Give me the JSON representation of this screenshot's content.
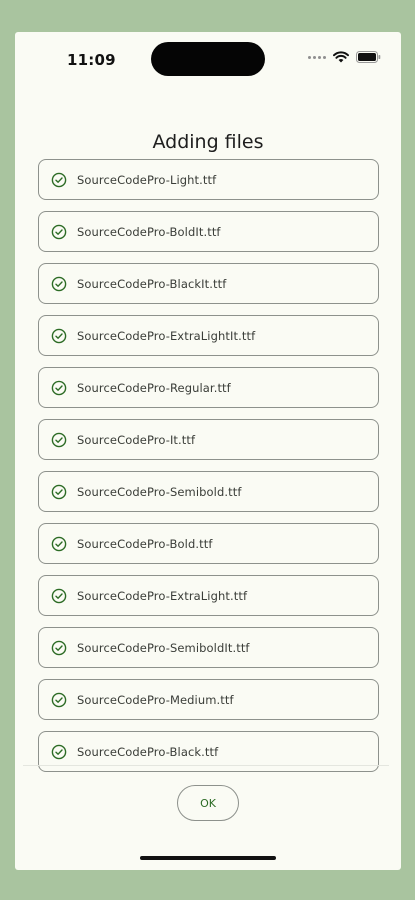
{
  "status_bar": {
    "time": "11:09",
    "icons": [
      "signal-dots-icon",
      "wifi-icon",
      "battery-icon"
    ]
  },
  "dialog": {
    "title": "Adding files",
    "files": [
      "SourceCodePro-Light.ttf",
      "SourceCodePro-BoldIt.ttf",
      "SourceCodePro-BlackIt.ttf",
      "SourceCodePro-ExtraLightIt.ttf",
      "SourceCodePro-Regular.ttf",
      "SourceCodePro-It.ttf",
      "SourceCodePro-Semibold.ttf",
      "SourceCodePro-Bold.ttf",
      "SourceCodePro-ExtraLight.ttf",
      "SourceCodePro-SemiboldIt.ttf",
      "SourceCodePro-Medium.ttf",
      "SourceCodePro-Black.ttf"
    ],
    "ok_label": "OK"
  },
  "colors": {
    "background": "#a9c49f",
    "surface": "#fafbf4",
    "accent": "#2c6b25",
    "outline": "#8d918c"
  }
}
